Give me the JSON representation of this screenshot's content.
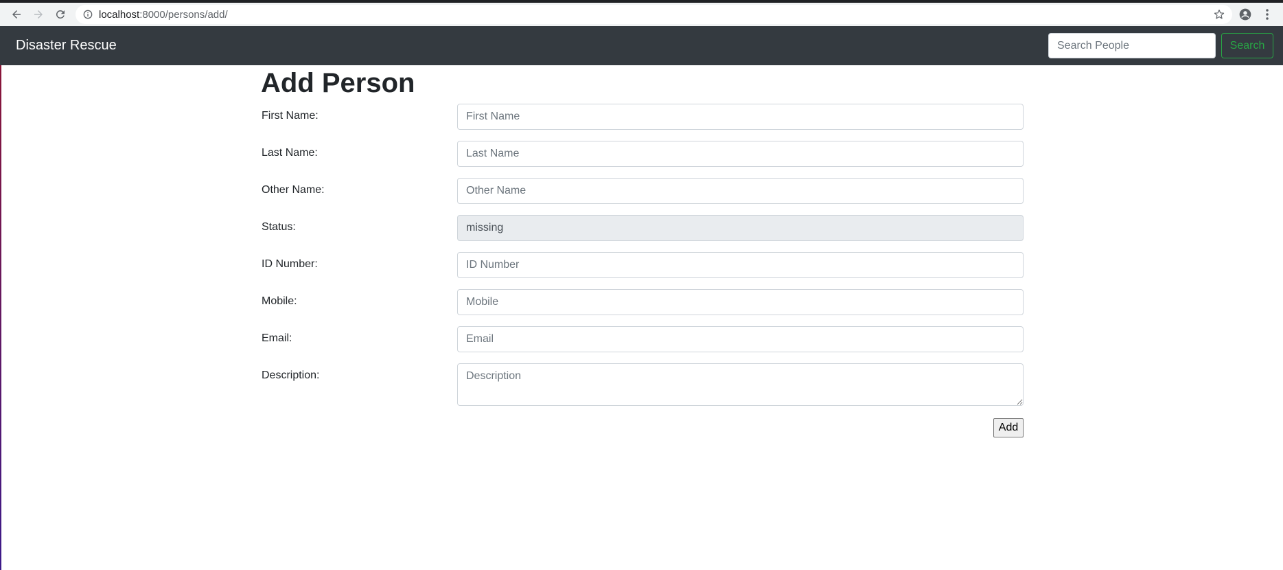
{
  "browser": {
    "url_host": "localhost",
    "url_path": ":8000/persons/add/"
  },
  "navbar": {
    "brand": "Disaster Rescue",
    "search_placeholder": "Search People",
    "search_button": "Search"
  },
  "form": {
    "title": "Add Person",
    "fields": [
      {
        "label": "First Name:",
        "placeholder": "First Name",
        "value": ""
      },
      {
        "label": "Last Name:",
        "placeholder": "Last Name",
        "value": ""
      },
      {
        "label": "Other Name:",
        "placeholder": "Other Name",
        "value": ""
      },
      {
        "label": "Status:",
        "placeholder": "",
        "value": "missing"
      },
      {
        "label": "ID Number:",
        "placeholder": "ID Number",
        "value": ""
      },
      {
        "label": "Mobile:",
        "placeholder": "Mobile",
        "value": ""
      },
      {
        "label": "Email:",
        "placeholder": "Email",
        "value": ""
      },
      {
        "label": "Description:",
        "placeholder": "Description",
        "value": ""
      }
    ],
    "submit_label": "Add"
  },
  "colors": {
    "navbar_bg": "#343a40",
    "search_button": "#28a745",
    "readonly_bg": "#e9ecef"
  }
}
